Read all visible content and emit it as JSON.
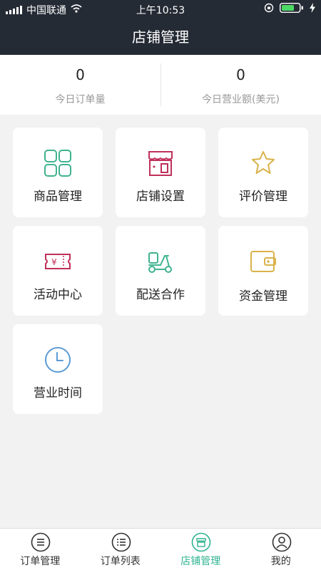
{
  "status_bar": {
    "carrier": "中国联通",
    "time": "上午10:53"
  },
  "header": {
    "title": "店铺管理"
  },
  "stats": [
    {
      "value": "0",
      "label": "今日订单量"
    },
    {
      "value": "0",
      "label": "今日营业额(美元)"
    }
  ],
  "tiles": [
    {
      "label": "商品管理",
      "icon": "grid-icon"
    },
    {
      "label": "店铺设置",
      "icon": "store-icon"
    },
    {
      "label": "评价管理",
      "icon": "star-icon"
    },
    {
      "label": "活动中心",
      "icon": "ticket-icon"
    },
    {
      "label": "配送合作",
      "icon": "scooter-icon"
    },
    {
      "label": "资金管理",
      "icon": "wallet-icon"
    },
    {
      "label": "营业时间",
      "icon": "clock-icon"
    }
  ],
  "tabbar": {
    "active_index": 2,
    "active_color": "#2fb391",
    "items": [
      {
        "label": "订单管理",
        "icon": "order-icon"
      },
      {
        "label": "订单列表",
        "icon": "list-icon"
      },
      {
        "label": "店铺管理",
        "icon": "shop-icon"
      },
      {
        "label": "我的",
        "icon": "profile-icon"
      }
    ]
  },
  "colors": {
    "header_bg": "#252b35",
    "accent": "#2fb391",
    "battery": "#4cd964"
  }
}
